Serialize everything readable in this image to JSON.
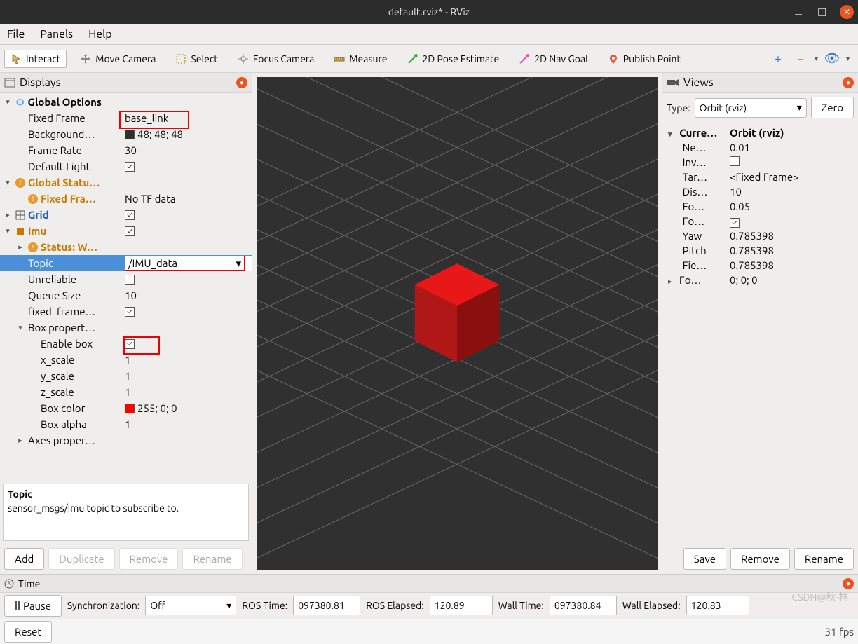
{
  "title": "default.rviz* - RViz",
  "menubar": [
    "File",
    "Panels",
    "Help"
  ],
  "toolbar": {
    "items": [
      {
        "icon": "interact",
        "label": "Interact",
        "active": true
      },
      {
        "icon": "move",
        "label": "Move Camera"
      },
      {
        "icon": "select",
        "label": "Select"
      },
      {
        "icon": "focus",
        "label": "Focus Camera"
      },
      {
        "icon": "measure",
        "label": "Measure"
      },
      {
        "icon": "pose",
        "label": "2D Pose Estimate"
      },
      {
        "icon": "nav",
        "label": "2D Nav Goal"
      },
      {
        "icon": "point",
        "label": "Publish Point"
      }
    ],
    "right_icons": [
      "+",
      "−",
      "👁"
    ]
  },
  "displays": {
    "title": "Displays",
    "rows": [
      {
        "level": 0,
        "expander": "▾",
        "icon": "gear",
        "label": "Global Options",
        "value": ""
      },
      {
        "level": 1,
        "label": "Fixed Frame",
        "value": "base_link",
        "highlight": true
      },
      {
        "level": 1,
        "label": "Background…",
        "value": "48; 48; 48",
        "swatch": "#303030"
      },
      {
        "level": 1,
        "label": "Frame Rate",
        "value": "30"
      },
      {
        "level": 1,
        "label": "Default Light",
        "checkbox": true,
        "checked": true
      },
      {
        "level": 0,
        "expander": "▾",
        "icon": "warn",
        "label": "Global Statu…",
        "warn": true
      },
      {
        "level": 1,
        "icon": "warn",
        "label": "Fixed Fra…",
        "value": "No TF data",
        "warn": true
      },
      {
        "level": 0,
        "expander": "▸",
        "icon": "grid",
        "label": "Grid",
        "gridlabel": true,
        "checkbox": true,
        "checked": true
      },
      {
        "level": 0,
        "expander": "▾",
        "icon": "imu",
        "label": "Imu",
        "warn": true,
        "checkbox": true,
        "checked": true
      },
      {
        "level": 1,
        "expander": "▸",
        "icon": "warn",
        "label": "Status: W…",
        "warn": true
      },
      {
        "level": 1,
        "label": "Topic",
        "value": "/IMU_data",
        "selected": true,
        "dropdown": true
      },
      {
        "level": 1,
        "label": "Unreliable",
        "checkbox": true,
        "checked": false
      },
      {
        "level": 1,
        "label": "Queue Size",
        "value": "10"
      },
      {
        "level": 1,
        "label": "fixed_frame…",
        "checkbox": true,
        "checked": true
      },
      {
        "level": 1,
        "expander": "▾",
        "label": "Box propert…"
      },
      {
        "level": 2,
        "label": "Enable box",
        "checkbox": true,
        "checked": true,
        "highlight2": true
      },
      {
        "level": 2,
        "label": "x_scale",
        "value": "1"
      },
      {
        "level": 2,
        "label": "y_scale",
        "value": "1"
      },
      {
        "level": 2,
        "label": "z_scale",
        "value": "1"
      },
      {
        "level": 2,
        "label": "Box color",
        "value": "255; 0; 0",
        "swatch": "#ff0000"
      },
      {
        "level": 2,
        "label": "Box alpha",
        "value": "1"
      },
      {
        "level": 1,
        "expander": "▸",
        "label": "Axes proper…"
      }
    ],
    "help": {
      "title": "Topic",
      "body": "sensor_msgs/Imu topic to subscribe to."
    },
    "buttons": [
      "Add",
      "Duplicate",
      "Remove",
      "Rename"
    ]
  },
  "views": {
    "title": "Views",
    "type_label": "Type:",
    "type_value": "Orbit (rviz)",
    "zero": "Zero",
    "rows": [
      {
        "k": "Curre…",
        "v": "Orbit (rviz)",
        "head": true,
        "exp": "▾"
      },
      {
        "k": "Ne…",
        "v": "0.01"
      },
      {
        "k": "Inv…",
        "v": "",
        "checkbox": true
      },
      {
        "k": "Tar…",
        "v": "<Fixed Frame>"
      },
      {
        "k": "Dis…",
        "v": "10"
      },
      {
        "k": "Fo…",
        "v": "0.05"
      },
      {
        "k": "Fo…",
        "v": "",
        "checkbox": true,
        "checked": true
      },
      {
        "k": "Yaw",
        "v": "0.785398"
      },
      {
        "k": "Pitch",
        "v": "0.785398"
      },
      {
        "k": "Fie…",
        "v": "0.785398"
      },
      {
        "k": "Fo…",
        "v": "0; 0; 0",
        "exp": "▸"
      }
    ],
    "buttons": [
      "Save",
      "Remove",
      "Rename"
    ]
  },
  "time": {
    "title": "Time",
    "pause": "Pause",
    "sync_label": "Synchronization:",
    "sync_value": "Off",
    "ros_time_label": "ROS Time:",
    "ros_time_value": "097380.81",
    "ros_elapsed_label": "ROS Elapsed:",
    "ros_elapsed_value": "120.89",
    "wall_time_label": "Wall Time:",
    "wall_time_value": "097380.84",
    "wall_elapsed_label": "Wall Elapsed:",
    "wall_elapsed_value": "120.83"
  },
  "bottom": {
    "reset": "Reset",
    "fps": "31 fps"
  },
  "watermark": "CSDN@秋·林"
}
